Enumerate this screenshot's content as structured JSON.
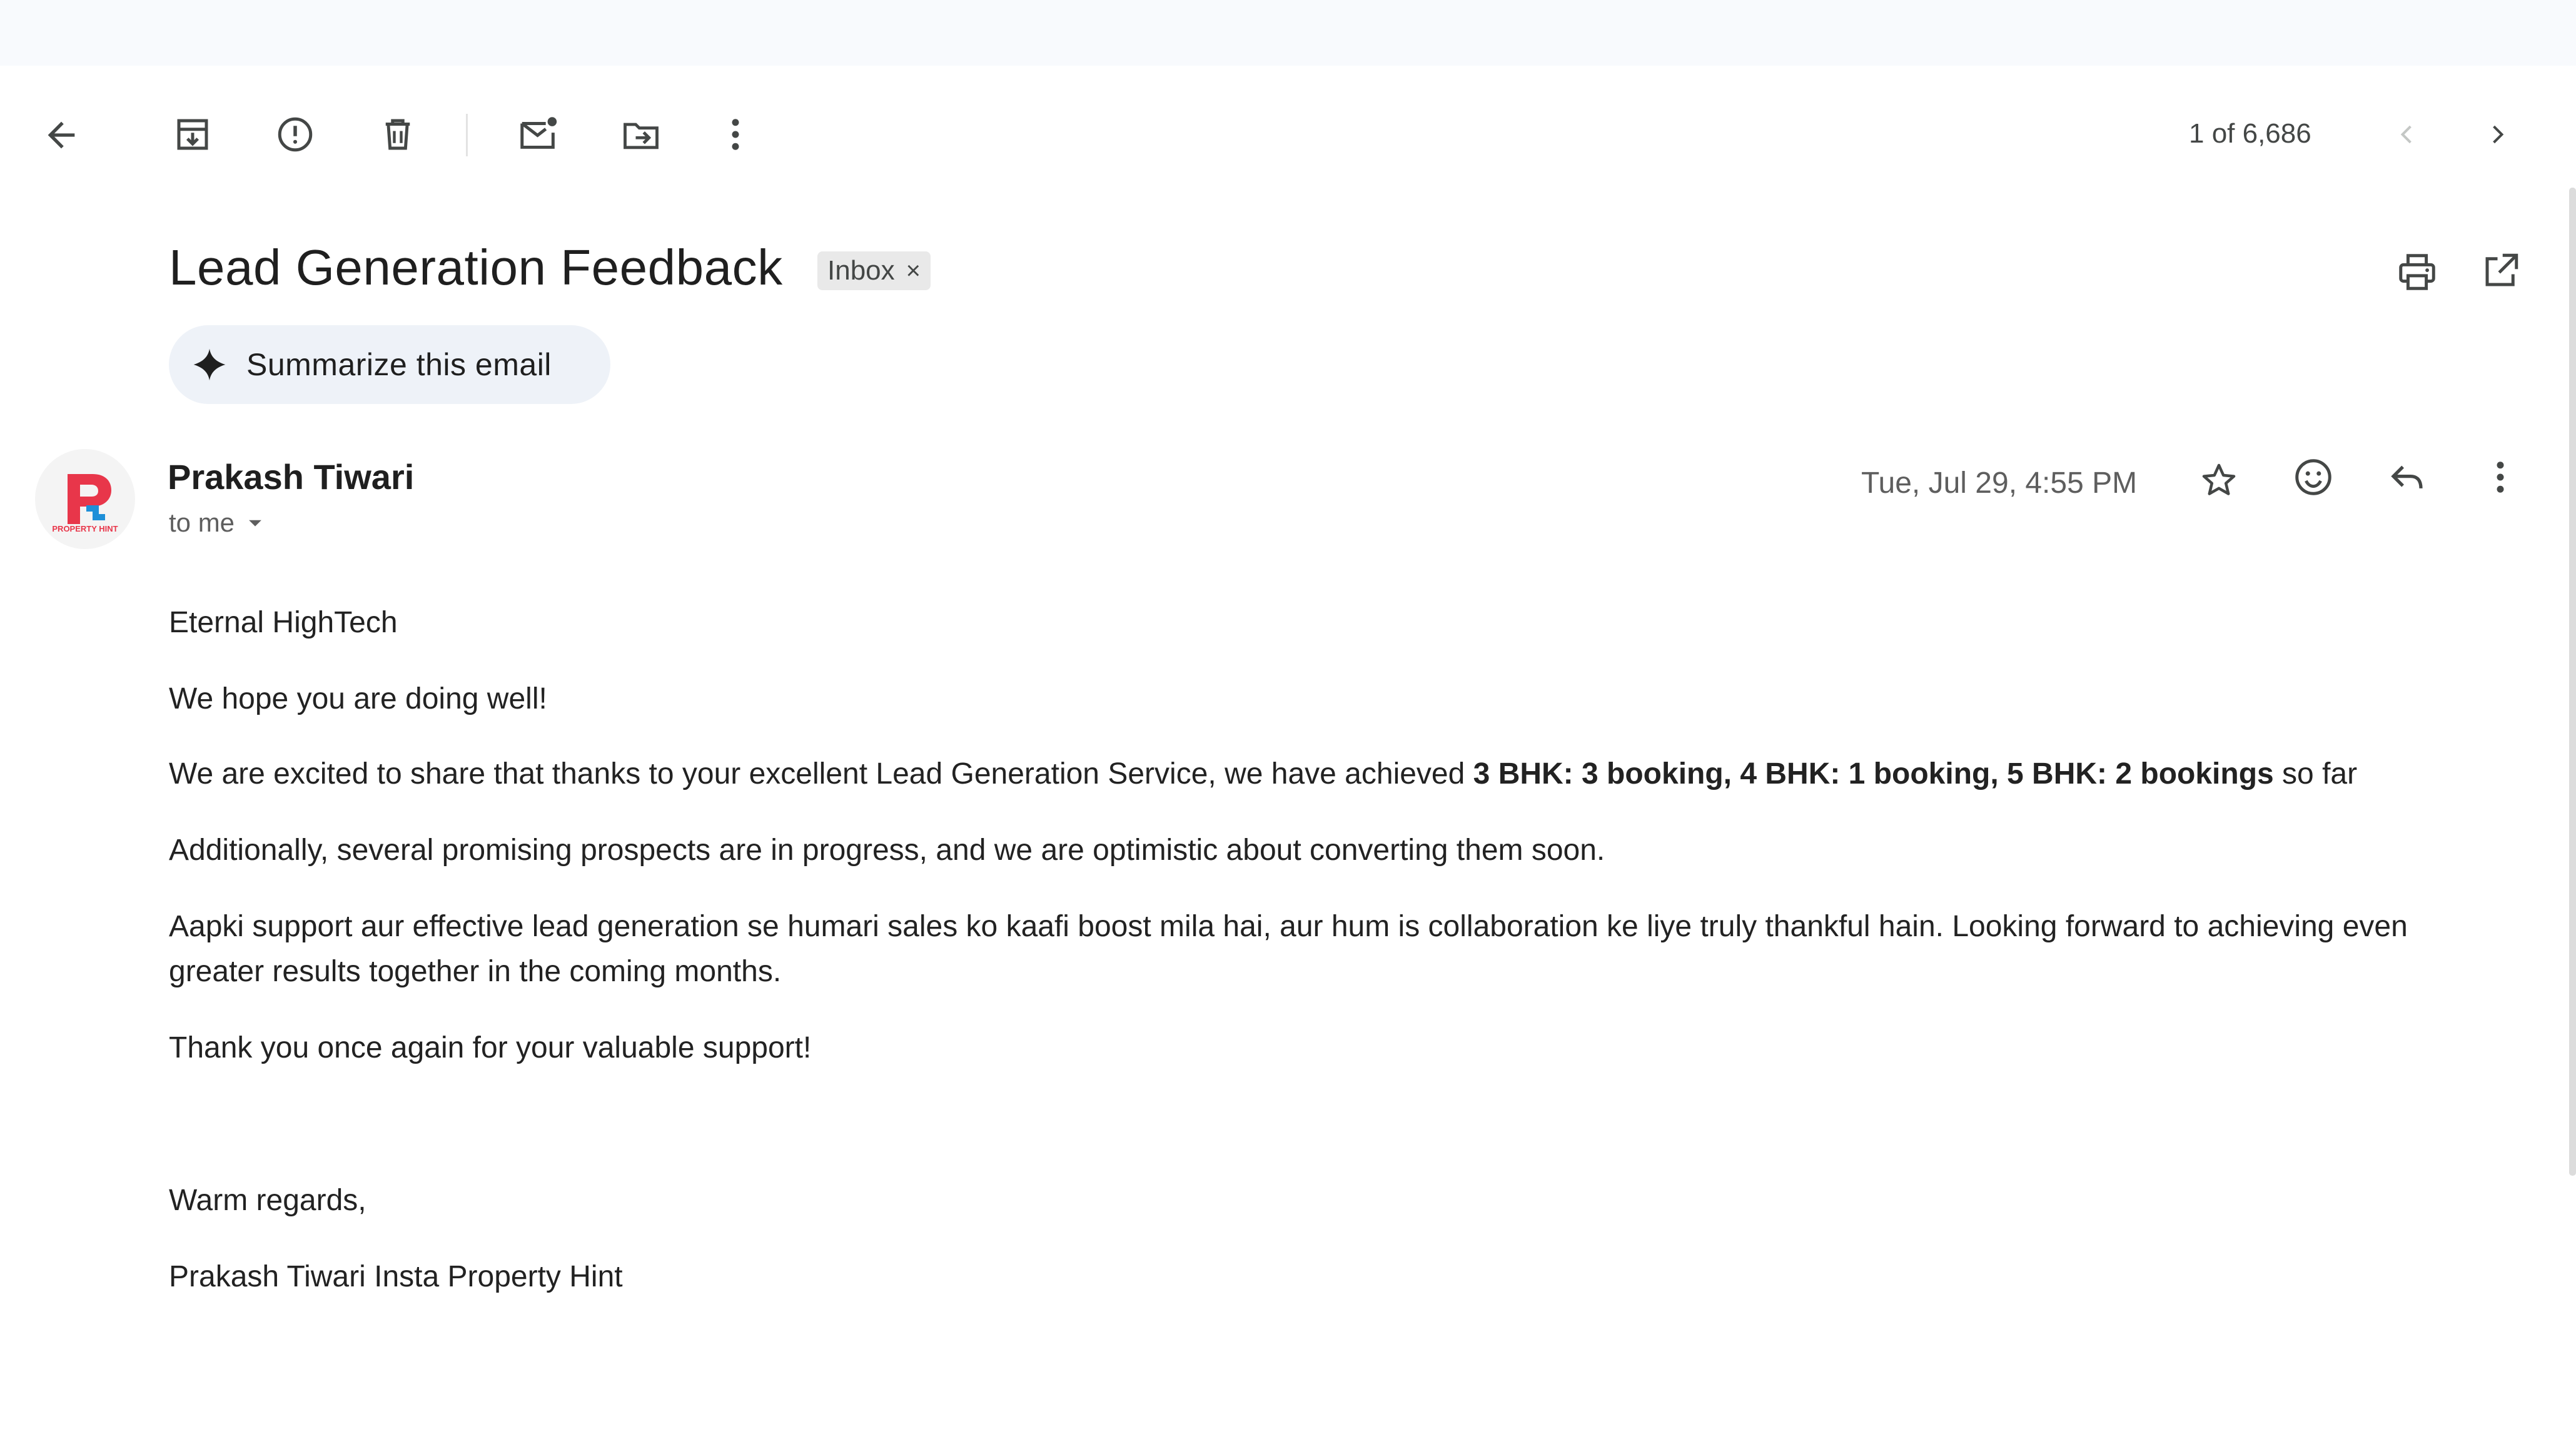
{
  "toolbar": {
    "back_icon": "arrow-left-icon",
    "archive_icon": "archive-icon",
    "spam_icon": "report-spam-icon",
    "delete_icon": "trash-icon",
    "unread_icon": "mark-unread-icon",
    "move_icon": "move-to-folder-icon",
    "more_icon": "more-vertical-icon",
    "counter": "1 of 6,686",
    "newer_icon": "chevron-left-icon",
    "older_icon": "chevron-right-icon"
  },
  "header": {
    "subject": "Lead Generation Feedback",
    "label": "Inbox",
    "label_remove": "×",
    "print_icon": "print-icon",
    "open_new_window_icon": "open-in-new-icon"
  },
  "summarize": {
    "label": "Summarize this email",
    "icon": "sparkle-icon"
  },
  "message": {
    "sender_name": "Prakash Tiwari",
    "recipient_line": "to me",
    "avatar_text": "PROPERTY HINT",
    "date": "Tue, Jul 29, 4:55 PM",
    "star_icon": "star-icon",
    "emoji_icon": "emoji-icon",
    "reply_icon": "reply-icon",
    "more_icon": "more-vertical-icon"
  },
  "body": {
    "greeting": "Eternal HighTech",
    "line1": "We hope you are doing well!",
    "line2_prefix": "We are excited to share that thanks to your excellent Lead Generation Service, we have achieved ",
    "line2_bold": "3 BHK: 3 booking, 4 BHK: 1 booking, 5 BHK: 2 bookings",
    "line2_suffix": " so far",
    "line3": "Additionally, several promising prospects are in progress, and we are optimistic about converting them soon.",
    "line4": "Aapki support aur effective lead generation se humari sales ko kaafi boost mila hai, aur hum is collaboration ke liye truly thankful hain. Looking forward to achieving even greater results together in the coming months.",
    "line5": "Thank you once again for your valuable support!",
    "closing": "Warm regards,",
    "signature": "Prakash Tiwari Insta Property Hint"
  },
  "colors": {
    "icon_gray": "#444746",
    "text_dark": "#1f1f1f",
    "body_text": "#222222",
    "summarize_bg": "#eef2f8",
    "avatar_red": "#e8364a",
    "avatar_blue": "#1e8fd8"
  }
}
